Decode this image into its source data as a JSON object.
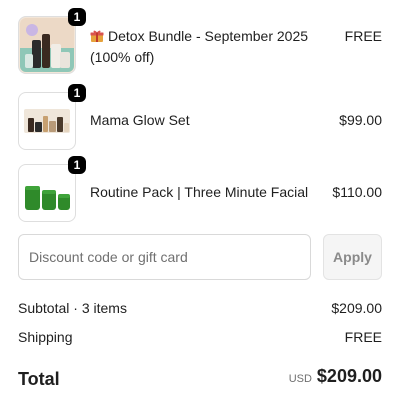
{
  "items": [
    {
      "quantity": "1",
      "gift_icon": "gift-box-icon",
      "title": "Detox Bundle - September 2025 (100% off)",
      "price": "FREE"
    },
    {
      "quantity": "1",
      "title": "Mama Glow Set",
      "price": "$99.00"
    },
    {
      "quantity": "1",
      "title": "Routine Pack | Three Minute Facial",
      "price": "$110.00"
    }
  ],
  "discount": {
    "placeholder": "Discount code or gift card",
    "apply_label": "Apply"
  },
  "summary": {
    "subtotal_label": "Subtotal · 3 items",
    "subtotal_value": "$209.00",
    "shipping_label": "Shipping",
    "shipping_value": "FREE",
    "total_label": "Total",
    "currency": "USD",
    "total_value": "$209.00"
  }
}
